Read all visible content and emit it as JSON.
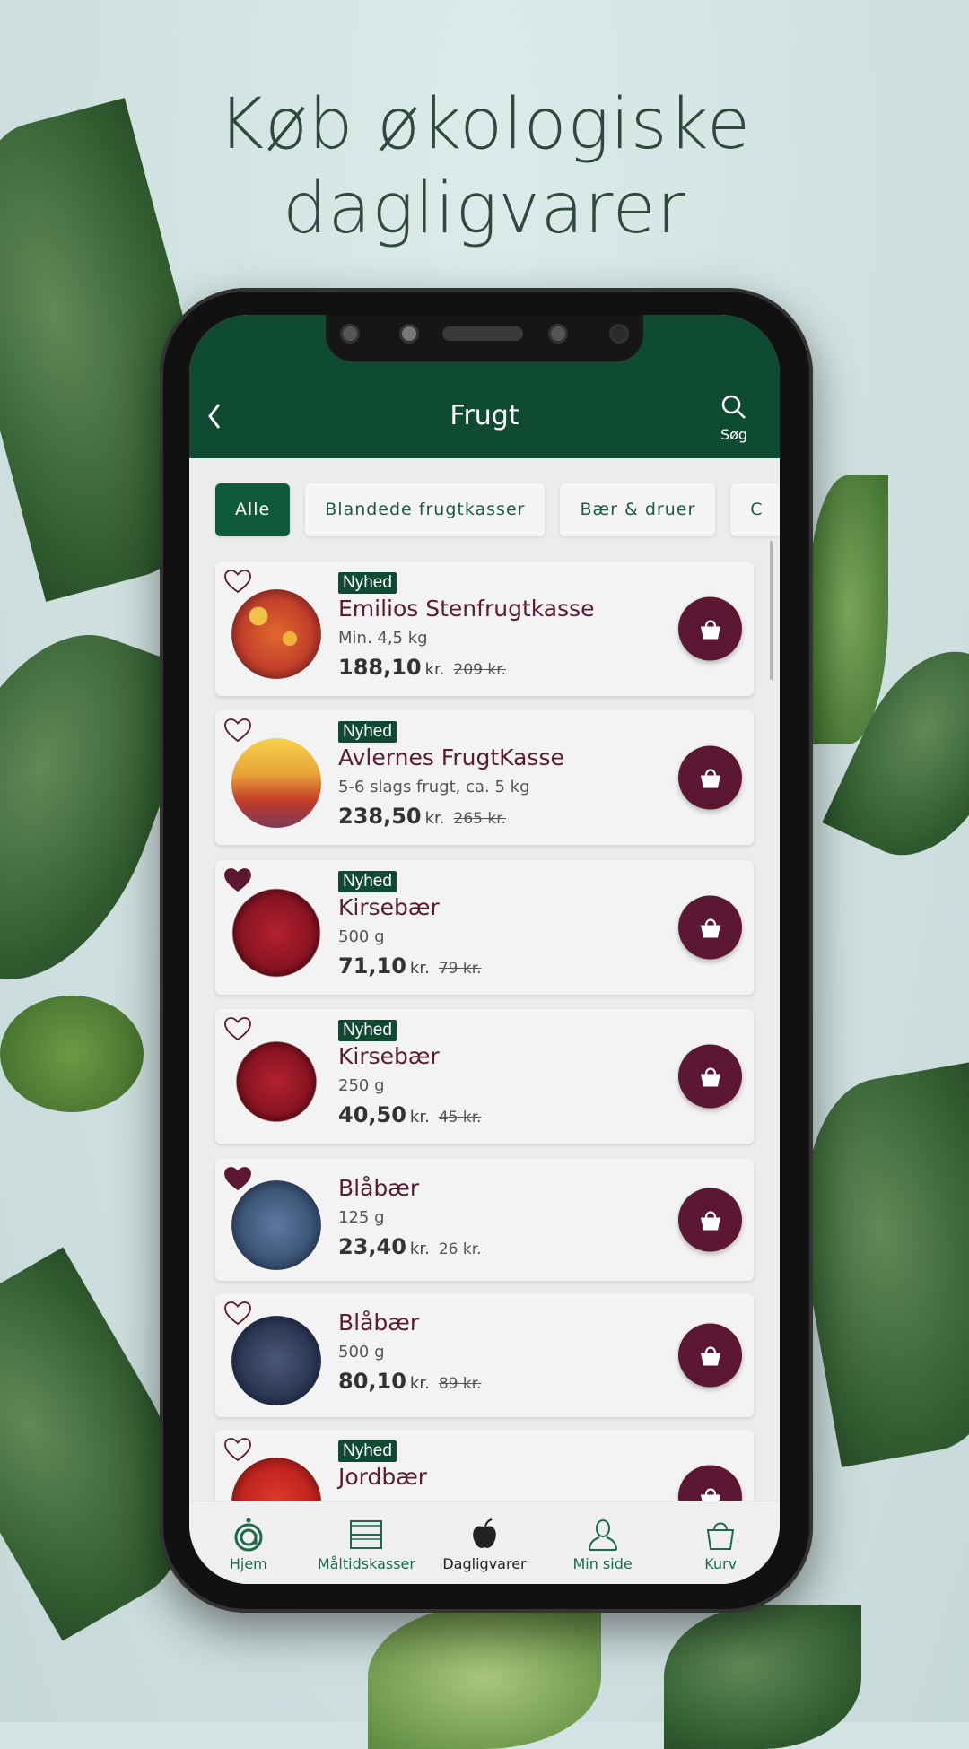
{
  "headline": {
    "line1": "Køb økologiske",
    "line2": "dagligvarer"
  },
  "header": {
    "title": "Frugt",
    "back_icon": "chevron-left-icon",
    "search_label": "Søg",
    "search_icon": "search-icon"
  },
  "chips": [
    {
      "label": "Alle",
      "active": true
    },
    {
      "label": "Blandede frugtkasser",
      "active": false
    },
    {
      "label": "Bær & druer",
      "active": false
    },
    {
      "label": "C",
      "active": false
    }
  ],
  "products": [
    {
      "badge": "Nyhed",
      "name": "Emilios Stenfrugtkasse",
      "sub": "Min. 4,5 kg",
      "price": "188,10",
      "unit": "kr.",
      "old_price": "209 kr.",
      "favorite": false
    },
    {
      "badge": "Nyhed",
      "name": "Avlernes FrugtKasse",
      "sub": "5-6 slags frugt, ca. 5 kg",
      "price": "238,50",
      "unit": "kr.",
      "old_price": "265 kr.",
      "favorite": false
    },
    {
      "badge": "Nyhed",
      "name": "Kirsebær",
      "sub": "500 g",
      "price": "71,10",
      "unit": "kr.",
      "old_price": "79 kr.",
      "favorite": true
    },
    {
      "badge": "Nyhed",
      "name": "Kirsebær",
      "sub": "250 g",
      "price": "40,50",
      "unit": "kr.",
      "old_price": "45 kr.",
      "favorite": false
    },
    {
      "badge": "",
      "name": "Blåbær",
      "sub": "125 g",
      "price": "23,40",
      "unit": "kr.",
      "old_price": "26 kr.",
      "favorite": true
    },
    {
      "badge": "",
      "name": "Blåbær",
      "sub": "500 g",
      "price": "80,10",
      "unit": "kr.",
      "old_price": "89 kr.",
      "favorite": false
    },
    {
      "badge": "Nyhed",
      "name": "Jordbær",
      "sub": "",
      "price": "",
      "unit": "",
      "old_price": "",
      "favorite": false
    }
  ],
  "nav": [
    {
      "label": "Hjem",
      "icon": "home-logo-icon"
    },
    {
      "label": "Måltidskasser",
      "icon": "box-icon"
    },
    {
      "label": "Dagligvarer",
      "icon": "apple-icon",
      "active": true
    },
    {
      "label": "Min side",
      "icon": "user-icon"
    },
    {
      "label": "Kurv",
      "icon": "basket-icon"
    }
  ],
  "colors": {
    "brand_green": "#0f4a33",
    "accent_wine": "#5c1733",
    "background": "#d3e3e3"
  }
}
